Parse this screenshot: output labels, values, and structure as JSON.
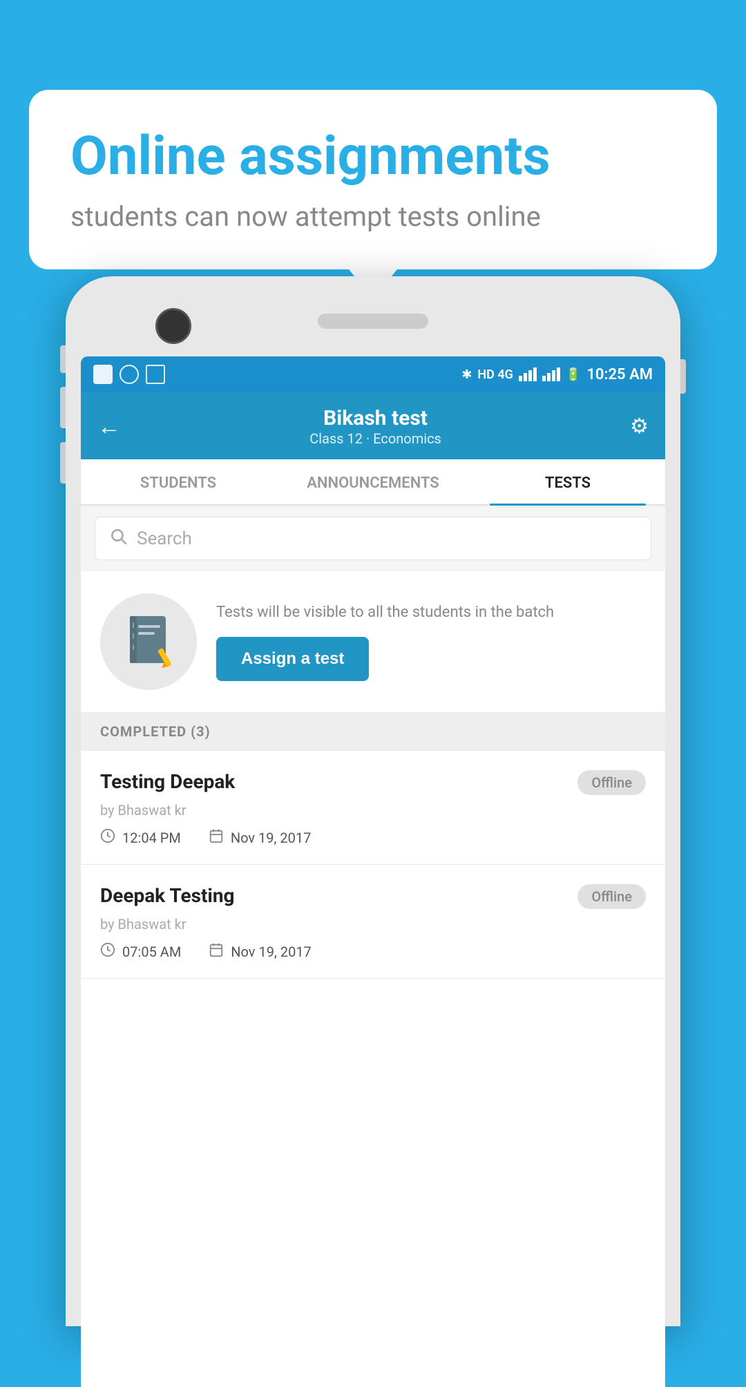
{
  "background_color": "#29aee6",
  "speech_bubble": {
    "title": "Online assignments",
    "subtitle": "students can now attempt tests online"
  },
  "status_bar": {
    "time": "10:25 AM",
    "network": "HD 4G"
  },
  "app_bar": {
    "title": "Bikash test",
    "subtitle": "Class 12 · Economics",
    "back_label": "←",
    "settings_label": "⚙"
  },
  "tabs": [
    {
      "label": "STUDENTS",
      "active": false
    },
    {
      "label": "ANNOUNCEMENTS",
      "active": false
    },
    {
      "label": "TESTS",
      "active": true
    }
  ],
  "search": {
    "placeholder": "Search"
  },
  "assign_section": {
    "description": "Tests will be visible to all the students in the batch",
    "button_label": "Assign a test"
  },
  "completed_header": "COMPLETED (3)",
  "test_items": [
    {
      "name": "Testing Deepak",
      "author": "by Bhaswat kr",
      "time": "12:04 PM",
      "date": "Nov 19, 2017",
      "status": "Offline"
    },
    {
      "name": "Deepak Testing",
      "author": "by Bhaswat kr",
      "time": "07:05 AM",
      "date": "Nov 19, 2017",
      "status": "Offline"
    }
  ]
}
